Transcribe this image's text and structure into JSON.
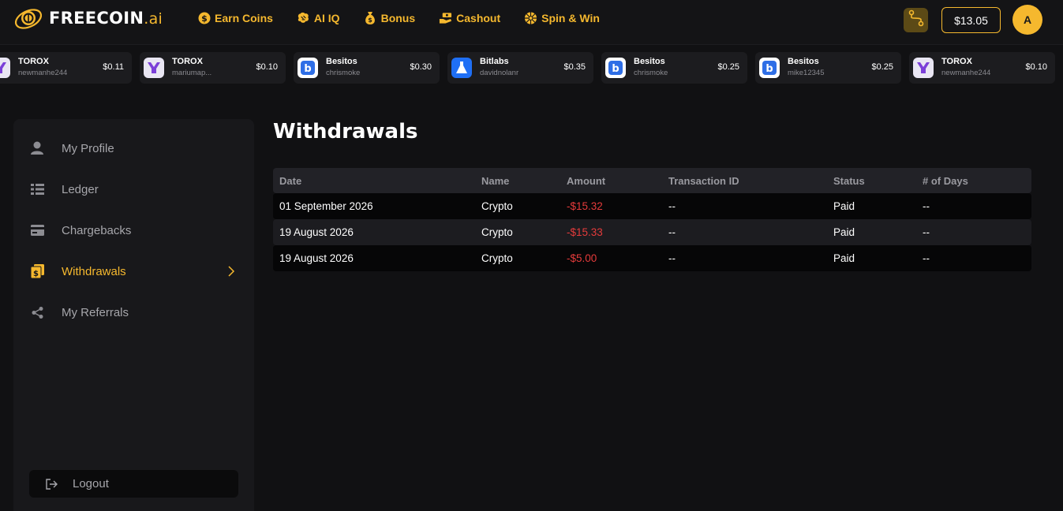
{
  "brand": {
    "name_free": "FREE",
    "name_coin": "COIN",
    "name_ai": ".ai",
    "accent": "#f5b82e"
  },
  "nav": [
    {
      "label": "Earn Coins",
      "icon": "dollar-coin-icon"
    },
    {
      "label": "AI IQ",
      "icon": "brain-icon"
    },
    {
      "label": "Bonus",
      "icon": "money-bag-icon"
    },
    {
      "label": "Cashout",
      "icon": "cash-hand-icon"
    },
    {
      "label": "Spin & Win",
      "icon": "wheel-icon"
    }
  ],
  "header": {
    "balance": "$13.05",
    "avatar_letter": "A",
    "route_icon": "route-icon"
  },
  "ticker": [
    {
      "name": "TOROX",
      "user": "newmanhe244",
      "price": "$0.11",
      "icon": "torox"
    },
    {
      "name": "TOROX",
      "user": "mariumap...",
      "price": "$0.10",
      "icon": "torox"
    },
    {
      "name": "Besitos",
      "user": "chrismoke",
      "price": "$0.30",
      "icon": "besitos"
    },
    {
      "name": "Bitlabs",
      "user": "davidnolanr",
      "price": "$0.35",
      "icon": "bitlabs"
    },
    {
      "name": "Besitos",
      "user": "chrismoke",
      "price": "$0.25",
      "icon": "besitos"
    },
    {
      "name": "Besitos",
      "user": "mike12345",
      "price": "$0.25",
      "icon": "besitos"
    },
    {
      "name": "TOROX",
      "user": "newmanhe244",
      "price": "$0.10",
      "icon": "torox"
    }
  ],
  "sidebar": {
    "items": [
      {
        "label": "My Profile",
        "icon": "user-icon",
        "active": false
      },
      {
        "label": "Ledger",
        "icon": "ledger-icon",
        "active": false
      },
      {
        "label": "Chargebacks",
        "icon": "card-icon",
        "active": false
      },
      {
        "label": "Withdrawals",
        "icon": "wallet-icon",
        "active": true
      },
      {
        "label": "My Referrals",
        "icon": "share-icon",
        "active": false
      }
    ],
    "logout_label": "Logout"
  },
  "main": {
    "title": "Withdrawals",
    "columns": [
      "Date",
      "Name",
      "Amount",
      "Transaction ID",
      "Status",
      "# of Days"
    ],
    "rows": [
      [
        "01 September 2026",
        "Crypto",
        "-$15.32",
        "--",
        "Paid",
        "--"
      ],
      [
        "19 August 2026",
        "Crypto",
        "-$15.33",
        "--",
        "Paid",
        "--"
      ],
      [
        "19 August 2026",
        "Crypto",
        "-$5.00",
        "--",
        "Paid",
        "--"
      ]
    ]
  }
}
